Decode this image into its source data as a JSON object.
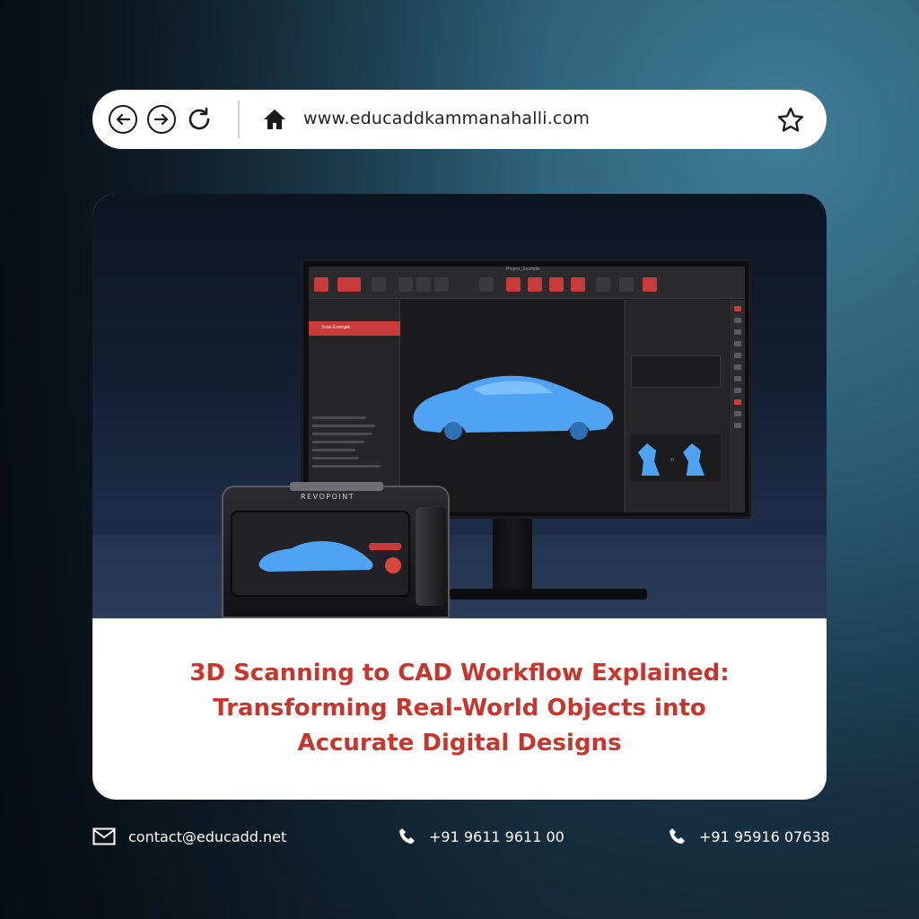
{
  "browser": {
    "url": "www.educaddkammanahalli.com",
    "back_icon": "arrow-left-icon",
    "forward_icon": "arrow-right-icon",
    "reload_icon": "reload-icon",
    "home_icon": "home-icon",
    "bookmark_icon": "star-icon"
  },
  "hero": {
    "monitor_title": "Project_Example",
    "scan_item": "Scan Example",
    "device_brand": "REVOPOINT"
  },
  "headline": {
    "line1": "3D Scanning to CAD Workflow Explained:",
    "line2": "Transforming Real-World Objects into",
    "line3": "Accurate Digital Designs"
  },
  "footer": {
    "email": "contact@educadd.net",
    "phone1": "+91 9611 9611 00",
    "phone2": "+91 95916 07638"
  },
  "colors": {
    "accent": "#c8352c",
    "background_dark": "#0d1b25",
    "background_teal": "#3f7d96",
    "card": "#ffffff"
  }
}
